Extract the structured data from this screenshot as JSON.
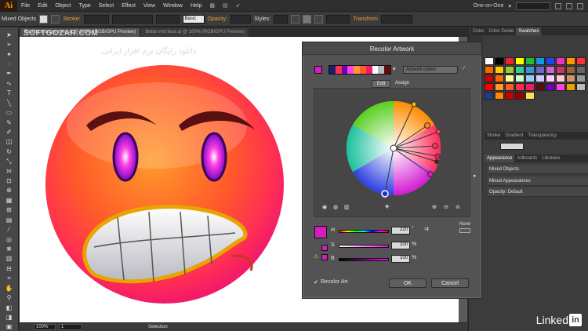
{
  "app": {
    "logo": "Ai",
    "menus": [
      "File",
      "Edit",
      "Object",
      "Type",
      "Select",
      "Effect",
      "View",
      "Window",
      "Help"
    ],
    "workspace": "One-on-One"
  },
  "control_bar": {
    "selection_label": "Mixed Objects",
    "stroke_label": "Stroke:",
    "brush_label": "Basic",
    "opacity_label": "Opacity:",
    "styles_label": "Styles:",
    "transform_label": "Transform"
  },
  "document": {
    "tab_active": "Red face angry eyes.ai @ 100% (RGB/GPU Preview)",
    "tab_inactive": "Better red face.ai @ 100% (RGB/GPU Preview)",
    "watermark": "SOFTGOZAR.COM",
    "watermark_ar": "دانلود رایگان نرم افزار ایرانی"
  },
  "status": {
    "zoom": "100%",
    "artboard": "1",
    "tool": "Selection"
  },
  "right_panels": {
    "tabs_top": [
      "Color",
      "Color Guide",
      "Swatches"
    ],
    "tabs_mid": [
      "Stroke",
      "Gradient",
      "Transparency"
    ],
    "tabs_app": [
      "Appearance",
      "Artboards",
      "Libraries"
    ],
    "appearance": [
      "Mixed Objects",
      "Mixed Appearances",
      "Opacity: Default"
    ]
  },
  "recolor": {
    "title": "Recolor Artwork",
    "artwork_colors": "Artwork colors",
    "tab_edit": "Edit",
    "tab_assign": "Assign",
    "h_label": "H",
    "s_label": "S",
    "b_label": "B",
    "h_value": "220",
    "s_value": "100",
    "b_value": "100",
    "unit_deg": "°",
    "unit_pct": "%",
    "none_label": "None",
    "recolor_art": "Recolor Art",
    "ok": "OK",
    "cancel": "Cancel",
    "current_color": "#d61bbf"
  },
  "branding": {
    "linkedin": "Linked",
    "linkedin_box": "in"
  }
}
